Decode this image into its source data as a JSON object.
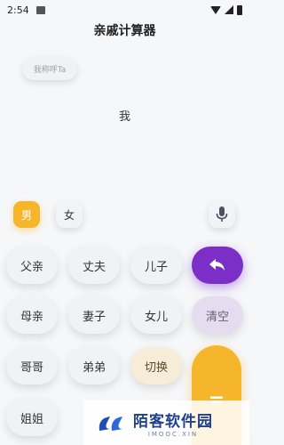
{
  "status_bar": {
    "time": "2:54",
    "icons": [
      "image-icon",
      "wifi-icon",
      "signal-icon",
      "battery-icon"
    ]
  },
  "app": {
    "title": "亲戚计算器"
  },
  "prompt": {
    "label": "我称呼Ta"
  },
  "result": {
    "text": "我"
  },
  "gender": {
    "male": "男",
    "female": "女"
  },
  "keys": {
    "row1": [
      "父亲",
      "丈夫",
      "儿子"
    ],
    "row2": [
      "母亲",
      "妻子",
      "女儿",
      "清空"
    ],
    "row3": [
      "哥哥",
      "弟弟",
      "切换"
    ],
    "row4": [
      "姐姐"
    ],
    "equals": "="
  },
  "watermark": {
    "title": "陌客软件园",
    "subtitle": "IMOOC.XIN"
  },
  "colors": {
    "accent_orange": "#f6b62b",
    "accent_purple": "#7b2fc7",
    "background": "#f6f7f9"
  }
}
